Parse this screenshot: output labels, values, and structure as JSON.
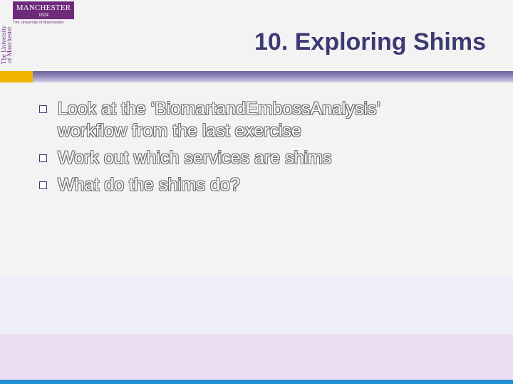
{
  "logo": {
    "wordmark": "MANCHESTER",
    "year": "1824",
    "subtitle": "The University of Manchester",
    "vertical_text": "The University\nof Manchester"
  },
  "slide": {
    "title": "10. Exploring Shims",
    "bullets": [
      {
        "lines": [
          "Look at the ‘BiomartandEmbossAnalysis’",
          "workflow from the last exercise"
        ]
      },
      {
        "lines": [
          "Work out which services are shims"
        ]
      },
      {
        "lines": [
          "What do the shims do?"
        ]
      }
    ]
  },
  "colors": {
    "title": "#3d3a72",
    "brand_purple": "#6e2b7a",
    "accent_gold": "#f0b400",
    "accent_bar": "#6a62a0",
    "bottom_line": "#1e8fd0"
  }
}
